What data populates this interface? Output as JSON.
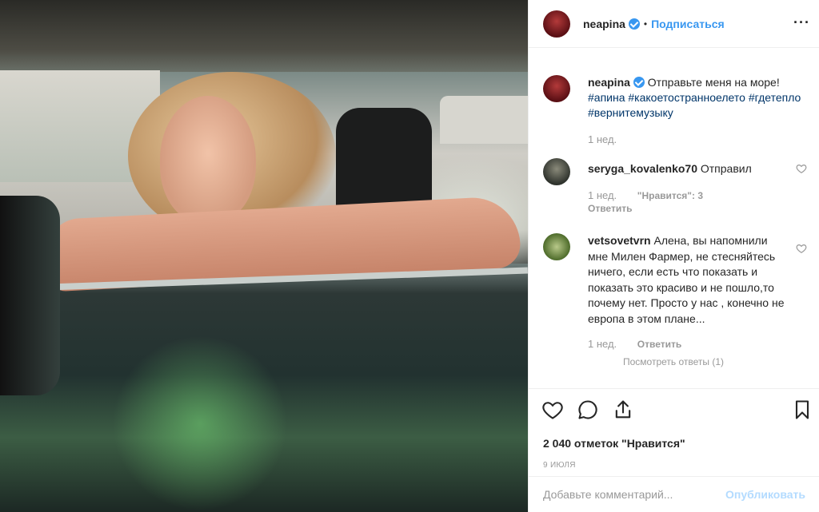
{
  "post": {
    "photo_alt": "",
    "likes": "2 040 отметок \"Нравится\"",
    "date": "9 июля"
  },
  "header": {
    "username": "neapina",
    "verified": true,
    "separator": "•",
    "follow_label": "Подписаться",
    "more_label": "···"
  },
  "caption": {
    "username": "neapina",
    "text": "Отправьте меня на море!",
    "tags": [
      "#апина",
      "#какоетостранноелето",
      "#гдетепло",
      "#вернитемузыку"
    ],
    "time": "1 нед."
  },
  "comments": [
    {
      "username": "seryga_kovalenko70",
      "text": "Отправил",
      "time": "1 нед.",
      "likes_label": "\"Нравится\": 3",
      "reply_label": "Ответить"
    },
    {
      "username": "vetsovetvrn",
      "text": "Алена, вы напомнили мне Милен Фармер, не стесняйтесь ничего, если есть что показать и показать это красиво и не пошло,то почему нет. Просто у нас , конечно не европа в этом плане...",
      "time": "1 нед.",
      "reply_label": "Ответить",
      "view_replies": "Посмотреть ответы (1)"
    }
  ],
  "add_comment": {
    "placeholder": "Добавьте комментарий...",
    "post_label": "Опубликовать"
  },
  "colors": {
    "link_blue": "#3897f0",
    "hashtag": "#003569",
    "muted": "#999999",
    "post_disabled": "#b3dbff"
  },
  "icons": [
    "heart-icon",
    "comment-icon",
    "share-icon",
    "bookmark-icon",
    "verified-badge-icon",
    "more-icon"
  ]
}
